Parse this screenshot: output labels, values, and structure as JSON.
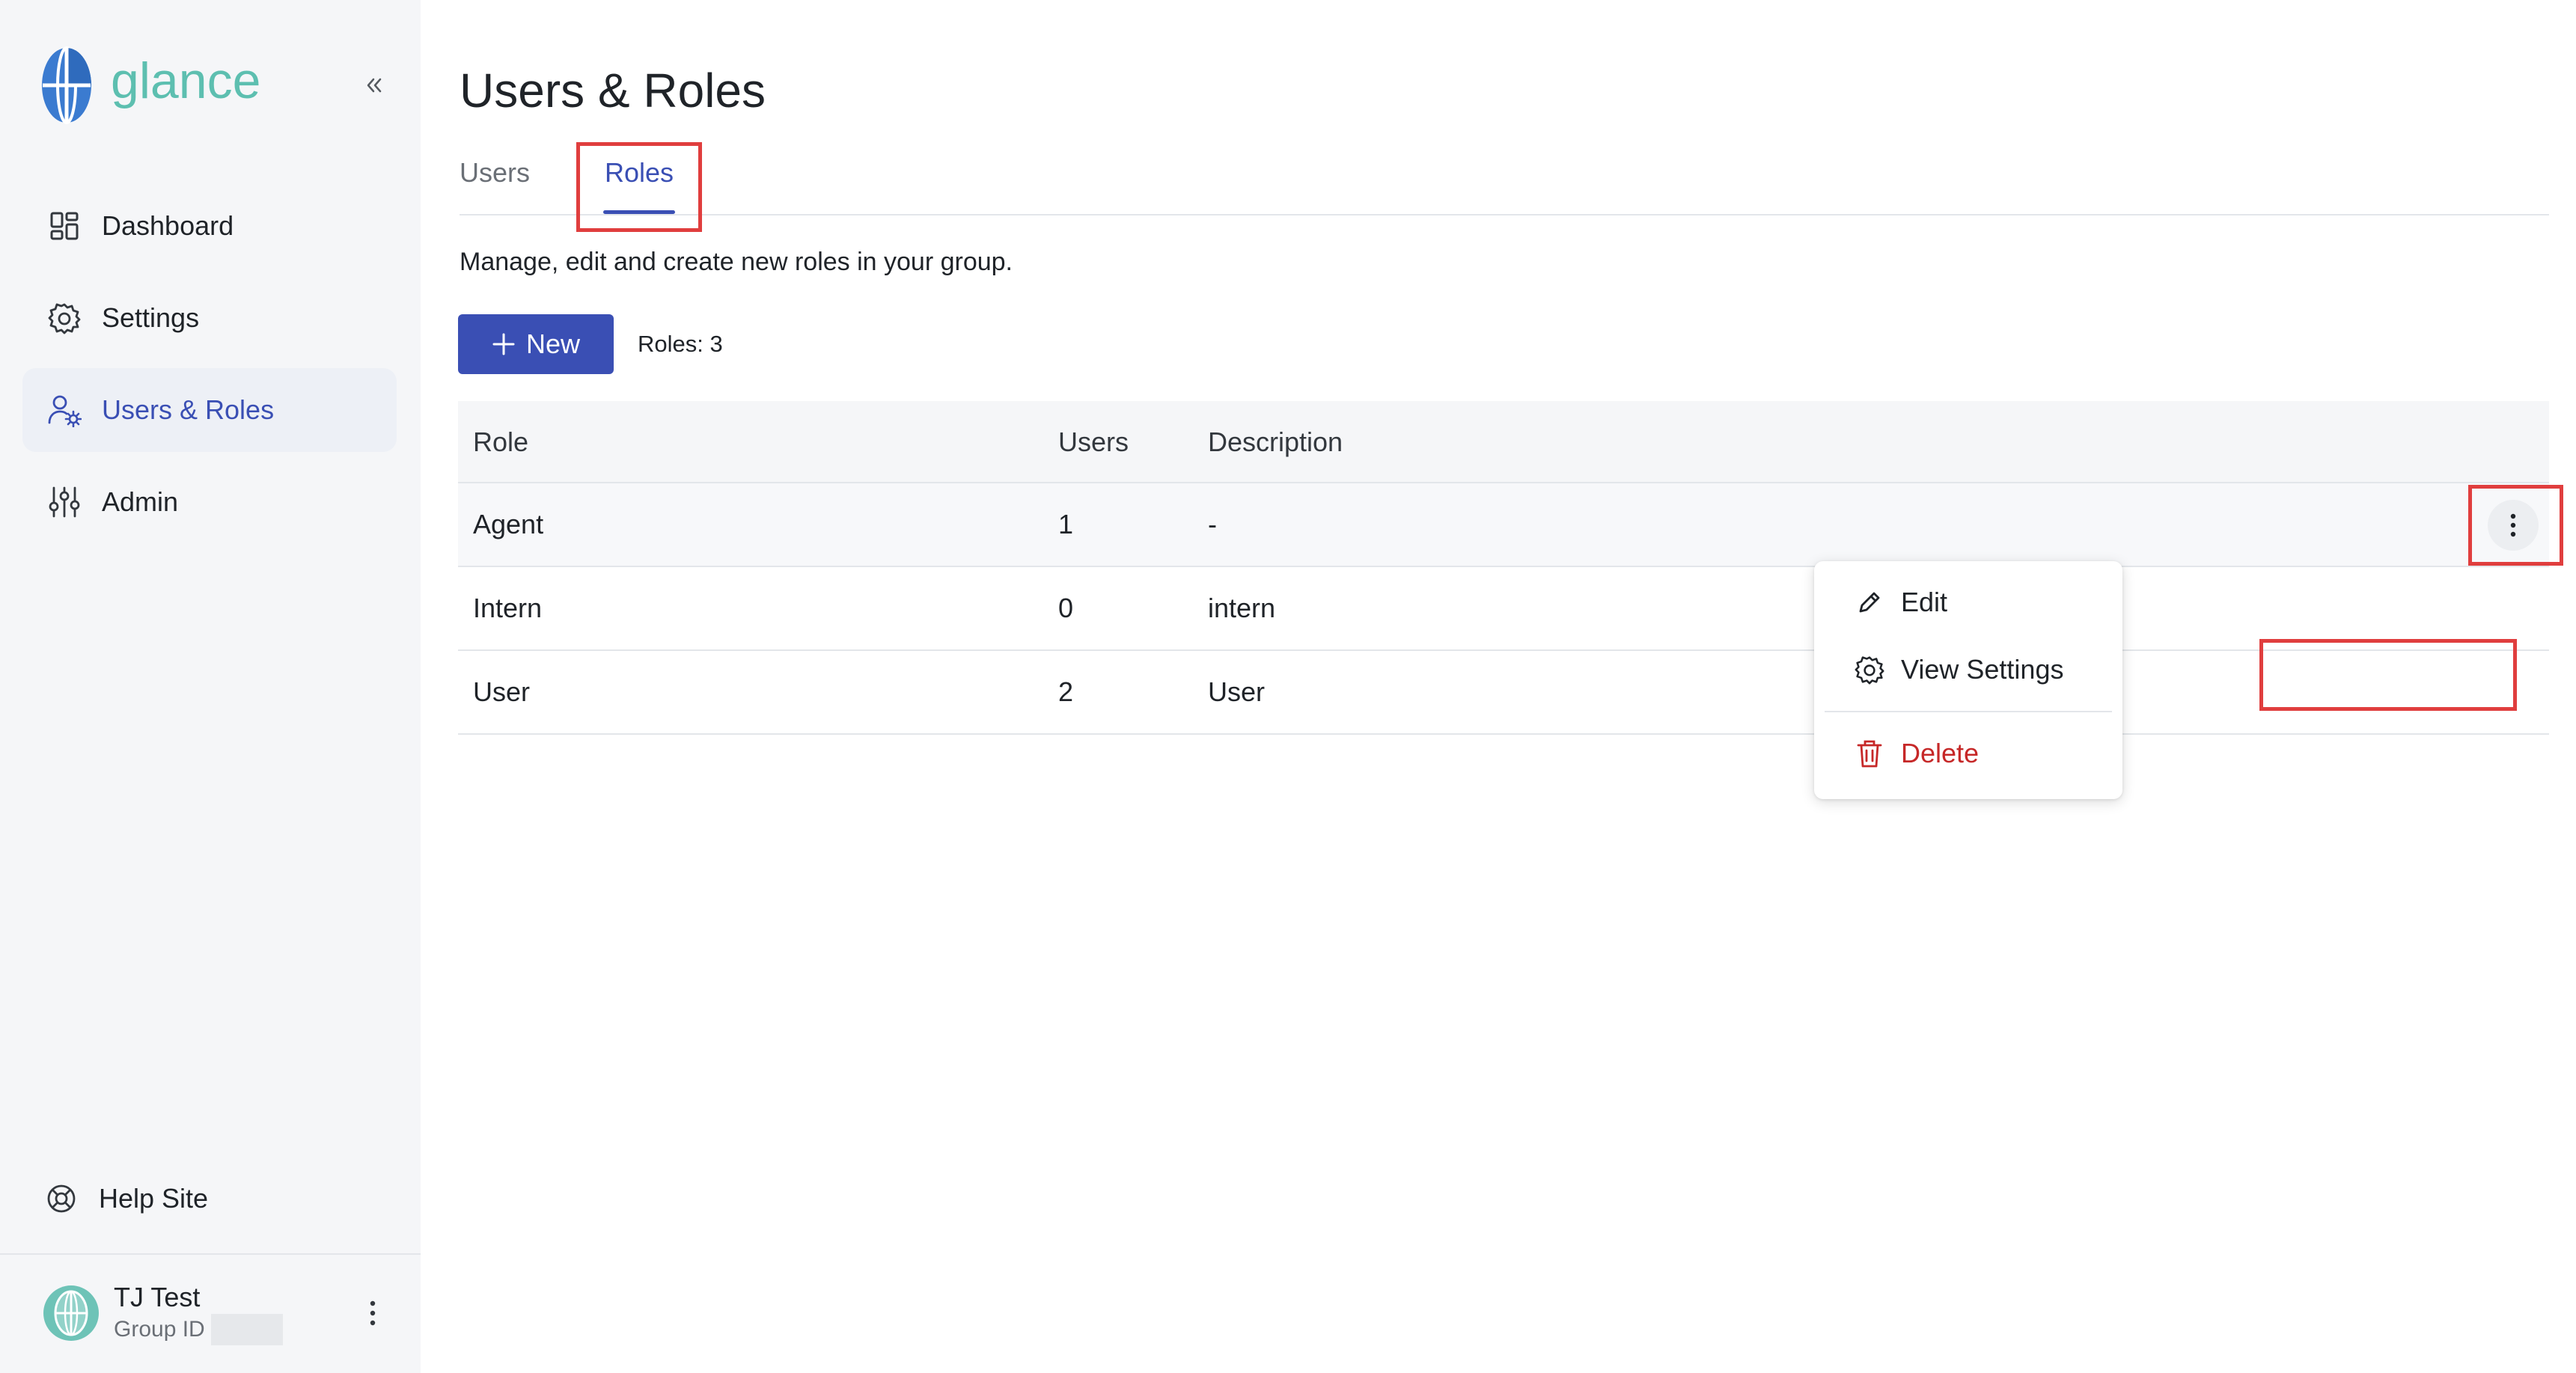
{
  "brand": {
    "name": "glance",
    "logo_icon": "glance-globe-icon",
    "color": "#5dbfb0"
  },
  "sidebar": {
    "collapse_icon": "chevrons-left-icon",
    "items": [
      {
        "label": "Dashboard",
        "icon": "dashboard-icon",
        "active": false
      },
      {
        "label": "Settings",
        "icon": "gear-icon",
        "active": false
      },
      {
        "label": "Users & Roles",
        "icon": "user-gear-icon",
        "active": true
      },
      {
        "label": "Admin",
        "icon": "sliders-icon",
        "active": false
      }
    ],
    "help": {
      "label": "Help Site",
      "icon": "lifebuoy-icon"
    },
    "user": {
      "name": "TJ Test",
      "group_label": "Group ID",
      "menu_icon": "kebab-icon"
    }
  },
  "main": {
    "title": "Users & Roles",
    "tabs": [
      {
        "label": "Users",
        "active": false
      },
      {
        "label": "Roles",
        "active": true
      }
    ],
    "subtitle": "Manage, edit and create new roles in your group.",
    "new_button": "New",
    "roles_count": "Roles: 3",
    "table": {
      "headers": [
        "Role",
        "Users",
        "Description"
      ],
      "rows": [
        {
          "role": "Agent",
          "users": "1",
          "description": "-"
        },
        {
          "role": "Intern",
          "users": "0",
          "description": "intern"
        },
        {
          "role": "User",
          "users": "2",
          "description": "User"
        }
      ]
    },
    "row_menu": {
      "items": [
        {
          "label": "Edit",
          "icon": "pencil-icon"
        },
        {
          "label": "View Settings",
          "icon": "gear-icon"
        },
        {
          "label": "Delete",
          "icon": "trash-icon"
        }
      ]
    }
  },
  "colors": {
    "accent": "#3a4fb4",
    "danger": "#c62828",
    "highlight": "#e03e3e",
    "sidebar_bg": "#f5f6f8"
  }
}
